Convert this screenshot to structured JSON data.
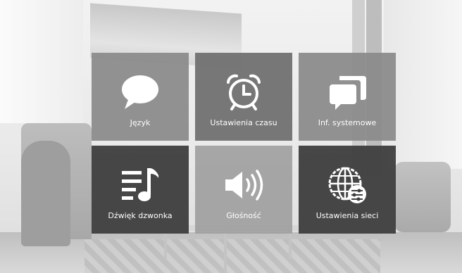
{
  "menu": {
    "tiles": [
      {
        "label": "Język",
        "icon": "speech-bubble-icon",
        "color": "#8a8a8a"
      },
      {
        "label": "Ustawienia czasu",
        "icon": "alarm-clock-icon",
        "color": "#707070"
      },
      {
        "label": "Inf. systemowe",
        "icon": "overlapping-windows-icon",
        "color": "#8a8a8a"
      },
      {
        "label": "Dźwięk dzwonka",
        "icon": "music-playlist-icon",
        "color": "#404040"
      },
      {
        "label": "Głośność",
        "icon": "speaker-volume-icon",
        "color": "#a0a0a0"
      },
      {
        "label": "Ustawienia sieci",
        "icon": "globe-network-settings-icon",
        "color": "#404040"
      }
    ]
  }
}
